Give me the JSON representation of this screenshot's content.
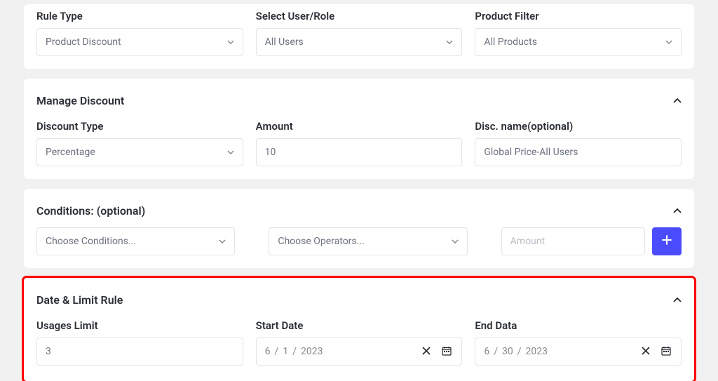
{
  "top": {
    "rule_type_label": "Rule Type",
    "rule_type_value": "Product Discount",
    "select_user_label": "Select User/Role",
    "select_user_value": "All Users",
    "product_filter_label": "Product Filter",
    "product_filter_value": "All Products"
  },
  "discount": {
    "section_title": "Manage Discount",
    "discount_type_label": "Discount Type",
    "discount_type_value": "Percentage",
    "amount_label": "Amount",
    "amount_value": "10",
    "disc_name_label": "Disc. name(optional)",
    "disc_name_value": "Global Price-All Users"
  },
  "conditions": {
    "section_title": "Conditions: (optional)",
    "choose_conditions": "Choose Conditions...",
    "choose_operators": "Choose Operators...",
    "amount_placeholder": "Amount"
  },
  "datelimit": {
    "section_title": "Date & Limit Rule",
    "usages_limit_label": "Usages Limit",
    "usages_limit_value": "3",
    "start_date_label": "Start Date",
    "start_date_m": "6",
    "start_date_d": "1",
    "start_date_y": "2023",
    "end_date_label": "End Data",
    "end_date_m": "6",
    "end_date_d": "30",
    "end_date_y": "2023",
    "sep": "/"
  }
}
